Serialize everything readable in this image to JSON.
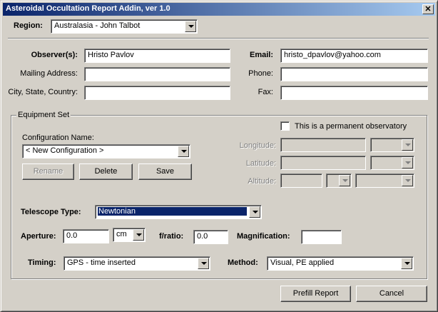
{
  "window": {
    "title": "Asteroidal Occultation Report Addin, ver 1.0",
    "close_glyph": "✕"
  },
  "region": {
    "label": "Region:",
    "value": "Australasia - John Talbot"
  },
  "observer": {
    "observers_label": "Observer(s):",
    "observers_value": "Hristo Pavlov",
    "email_label": "Email:",
    "email_value": "hristo_dpavlov@yahoo.com",
    "mailing_label": "Mailing Address:",
    "mailing_value": "",
    "phone_label": "Phone:",
    "phone_value": "",
    "city_label": "City, State, Country:",
    "city_value": "",
    "fax_label": "Fax:",
    "fax_value": ""
  },
  "equipment": {
    "group_label": "Equipment Set",
    "permanent_label": "This is a permanent observatory",
    "permanent_checked": false,
    "config_label": "Configuration Name:",
    "config_value": "< New Configuration >",
    "rename_label": "Rename",
    "delete_label": "Delete",
    "save_label": "Save",
    "longitude_label": "Longitude:",
    "latitude_label": "Latitude:",
    "altitude_label": "Altitude:"
  },
  "telescope": {
    "type_label": "Telescope Type:",
    "type_value": "Newtonian",
    "aperture_label": "Aperture:",
    "aperture_value": "0.0",
    "aperture_unit": "cm",
    "fratio_label": "f/ratio:",
    "fratio_value": "0.0",
    "magnification_label": "Magnification:",
    "magnification_value": ""
  },
  "timing": {
    "timing_label": "Timing:",
    "timing_value": "GPS - time inserted",
    "method_label": "Method:",
    "method_value": "Visual, PE applied"
  },
  "footer": {
    "prefill_label": "Prefill Report",
    "cancel_label": "Cancel"
  },
  "colors": {
    "titlebar_start": "#0a246a",
    "titlebar_end": "#a6caf0",
    "face": "#d4d0c8",
    "selection": "#0a246a"
  }
}
